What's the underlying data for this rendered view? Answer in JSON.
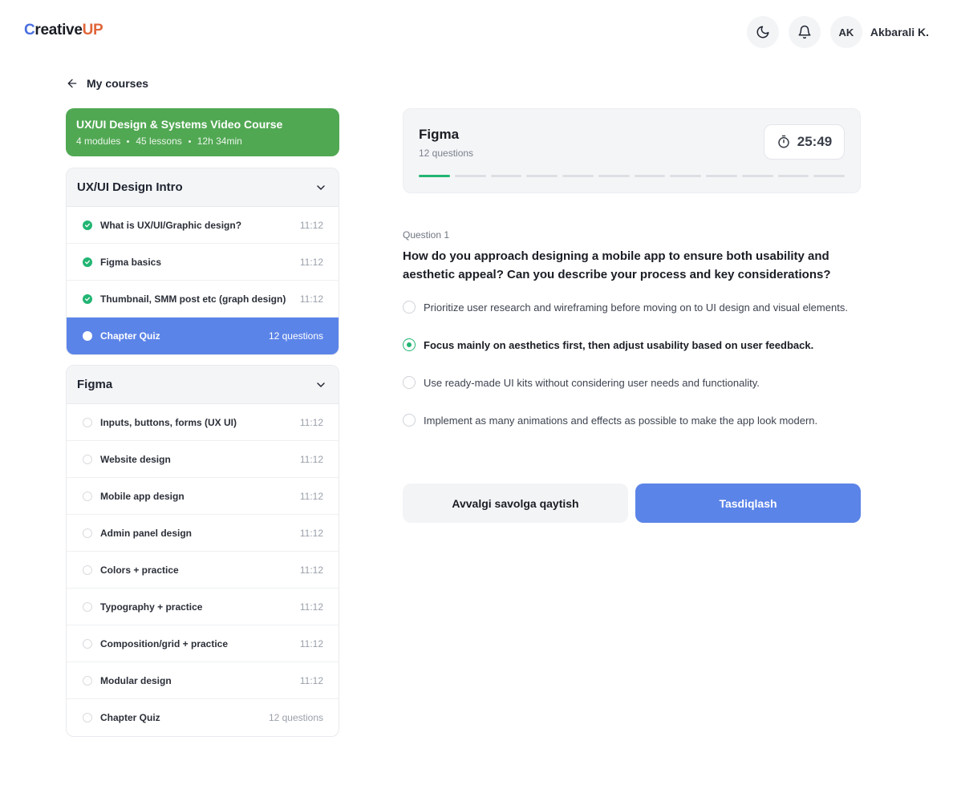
{
  "brand": {
    "part1": "C",
    "part2": "reative",
    "part3": "UP"
  },
  "header": {
    "avatar_initials": "AK",
    "user_name": "Akbarali K.",
    "theme_icon": "moon-icon",
    "notify_icon": "bell-icon"
  },
  "nav": {
    "back_label": "My courses"
  },
  "course": {
    "title": "UX/UI Design & Systems Video Course",
    "modules": "4 modules",
    "lessons": "45 lessons",
    "duration": "12h 34min"
  },
  "modules": [
    {
      "title": "UX/UI Design Intro",
      "lessons": [
        {
          "name": "What is UX/UI/Graphic design?",
          "time": "11:12",
          "status": "done"
        },
        {
          "name": "Figma basics",
          "time": "11:12",
          "status": "done"
        },
        {
          "name": "Thumbnail, SMM post etc (graph design)",
          "time": "11:12",
          "status": "done"
        },
        {
          "name": "Chapter Quiz",
          "time": "12 questions",
          "status": "active"
        }
      ]
    },
    {
      "title": "Figma",
      "lessons": [
        {
          "name": "Inputs, buttons, forms (UX UI)",
          "time": "11:12",
          "status": "todo"
        },
        {
          "name": "Website design",
          "time": "11:12",
          "status": "todo"
        },
        {
          "name": "Mobile app design",
          "time": "11:12",
          "status": "todo"
        },
        {
          "name": "Admin panel design",
          "time": "11:12",
          "status": "todo"
        },
        {
          "name": "Colors + practice",
          "time": "11:12",
          "status": "todo"
        },
        {
          "name": "Typography + practice",
          "time": "11:12",
          "status": "todo"
        },
        {
          "name": "Composition/grid + practice",
          "time": "11:12",
          "status": "todo"
        },
        {
          "name": "Modular design",
          "time": "11:12",
          "status": "todo"
        },
        {
          "name": "Chapter Quiz",
          "time": "12 questions",
          "status": "todo"
        }
      ]
    }
  ],
  "quiz": {
    "title": "Figma",
    "subtitle": "12 questions",
    "timer": "25:49",
    "progress_total": 12,
    "progress_current": 1
  },
  "question": {
    "label": "Question 1",
    "text": "How do you approach designing a mobile app to ensure both usability and aesthetic appeal? Can you describe your process and key considerations?",
    "options": [
      {
        "text": "Prioritize user research and wireframing before moving on to UI design and visual elements.",
        "selected": false
      },
      {
        "text": "Focus mainly on aesthetics first, then adjust usability based on user feedback.",
        "selected": true
      },
      {
        "text": "Use ready-made UI kits without considering user needs and functionality.",
        "selected": false
      },
      {
        "text": "Implement as many animations and effects as possible to make the app look modern.",
        "selected": false
      }
    ]
  },
  "actions": {
    "prev_label": "Avvalgi savolga qaytish",
    "confirm_label": "Tasdiqlash"
  },
  "colors": {
    "green": "#51a853",
    "accent": "#5b84e8",
    "success": "#22b573"
  }
}
